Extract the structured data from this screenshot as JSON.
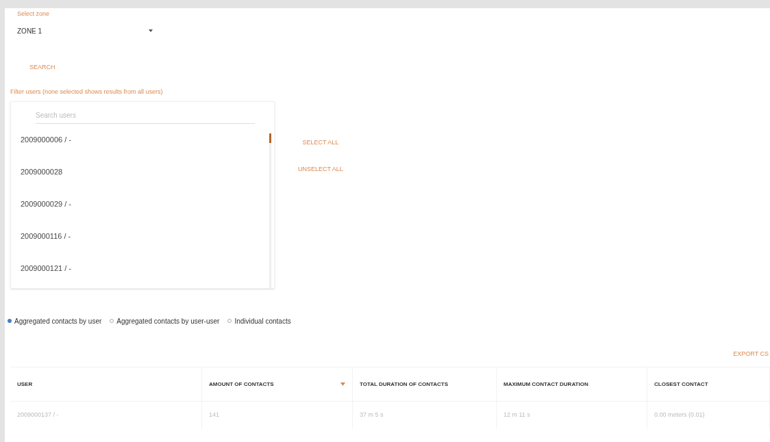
{
  "zone": {
    "label": "Select zone",
    "value": "ZONE 1"
  },
  "search_button": "SEARCH",
  "filter": {
    "label": "Filter users (none selected shows results from all users)",
    "placeholder": "Search users",
    "users": [
      "2009000006 / -",
      "2009000028",
      "2009000029 / -",
      "2009000116 / -",
      "2009000121 / -"
    ],
    "select_all": "SELECT ALL",
    "unselect_all": "UNSELECT ALL"
  },
  "modes": [
    {
      "label": "Aggregated contacts by user",
      "selected": true
    },
    {
      "label": "Aggregated contacts by user-user",
      "selected": false
    },
    {
      "label": "Individual contacts",
      "selected": false
    }
  ],
  "export_button": "EXPORT CS",
  "table": {
    "columns": [
      {
        "label": "USER",
        "sorted": false
      },
      {
        "label": "AMOUNT OF CONTACTS",
        "sorted": true
      },
      {
        "label": "TOTAL DURATION OF CONTACTS",
        "sorted": false
      },
      {
        "label": "MAXIMUM CONTACT DURATION",
        "sorted": false
      },
      {
        "label": "CLOSEST CONTACT",
        "sorted": false
      }
    ],
    "rows": [
      [
        "2009000137 / -",
        "141",
        "37 m 5 s",
        "12 m 11 s",
        "0.00 meters (0.01)"
      ]
    ]
  }
}
